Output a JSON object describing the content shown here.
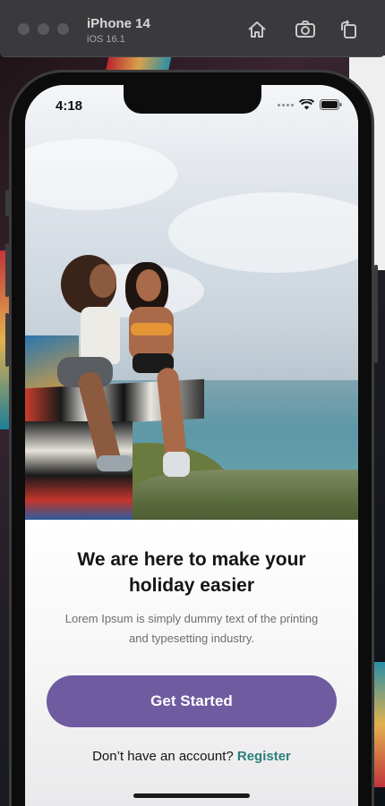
{
  "simulator": {
    "device_name": "iPhone 14",
    "os_version": "iOS 16.1",
    "icons": [
      "home-icon",
      "screenshot-icon",
      "rotate-icon"
    ]
  },
  "status_bar": {
    "time": "4:18",
    "icons": [
      "cellular-dots-icon",
      "wifi-icon",
      "battery-icon"
    ]
  },
  "onboarding": {
    "headline": "We are here to make your holiday easier",
    "subtext": "Lorem Ipsum is simply dummy text of the printing and typesetting industry.",
    "cta_label": "Get Started",
    "account_prompt": "Don’t have an account?",
    "register_label": "Register"
  },
  "colors": {
    "primary_button": "#6e5ba0",
    "register_link": "#2b7f7a"
  }
}
